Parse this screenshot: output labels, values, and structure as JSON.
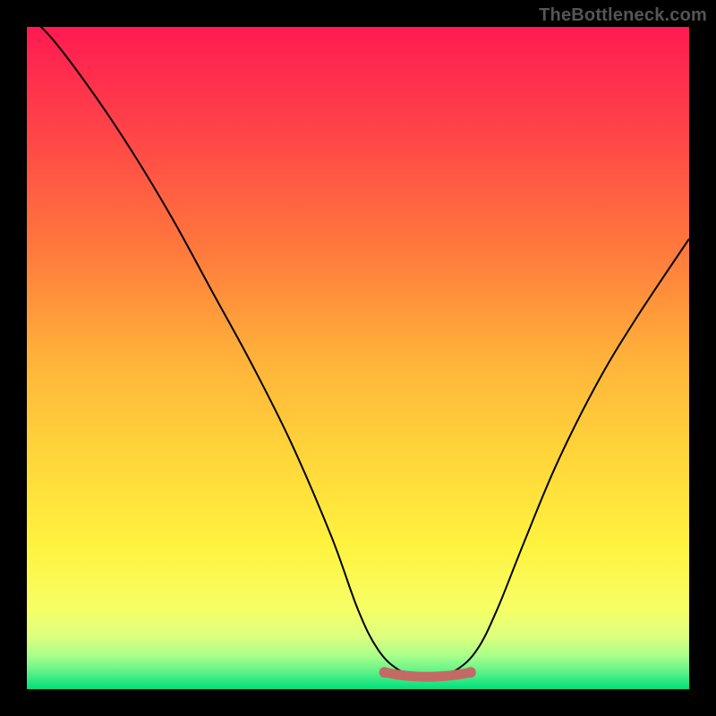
{
  "watermark": "TheBottleneck.com",
  "chart_data": {
    "type": "line",
    "title": "",
    "xlabel": "",
    "ylabel": "",
    "xlim": [
      0,
      100
    ],
    "ylim": [
      0,
      100
    ],
    "background_gradient": {
      "top": "#ff1a52",
      "mid_upper": "#ff7a3c",
      "mid": "#ffd43a",
      "mid_lower": "#f6ff66",
      "bottom": "#00e07a"
    },
    "series": [
      {
        "name": "bottleneck-curve",
        "x": [
          0,
          4,
          10,
          16,
          22,
          28,
          34,
          40,
          46,
          50,
          53,
          56,
          59,
          62,
          65,
          68,
          71,
          75,
          80,
          86,
          92,
          100
        ],
        "y": [
          102,
          98,
          90,
          81,
          71,
          60,
          49,
          37,
          23,
          12,
          6,
          3,
          2,
          2,
          3,
          6,
          12,
          22,
          34,
          46,
          56,
          68
        ]
      }
    ],
    "optimal_band": {
      "name": "optimal-range",
      "x_start": 54,
      "x_end": 67,
      "y": 2,
      "color": "#c46a65"
    },
    "annotations": []
  }
}
